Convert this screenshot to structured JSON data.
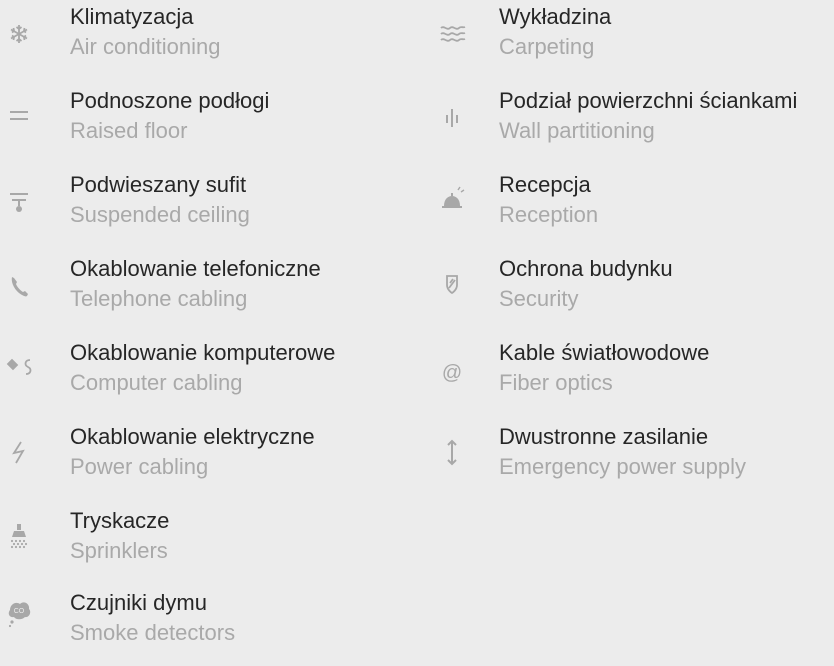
{
  "left_column": [
    {
      "icon": "snowflake-icon",
      "pl": "Klimatyzacja",
      "en": "Air conditioning"
    },
    {
      "icon": "raised-floor-icon",
      "pl": "Podnoszone podłogi",
      "en": "Raised floor"
    },
    {
      "icon": "suspended-ceiling-icon",
      "pl": "Podwieszany sufit",
      "en": "Suspended ceiling"
    },
    {
      "icon": "phone-icon",
      "pl": "Okablowanie telefoniczne",
      "en": "Telephone cabling"
    },
    {
      "icon": "computer-cable-icon",
      "pl": "Okablowanie komputerowe",
      "en": "Computer cabling"
    },
    {
      "icon": "lightning-icon",
      "pl": "Okablowanie elektryczne",
      "en": "Power cabling"
    },
    {
      "icon": "sprinkler-icon",
      "pl": "Tryskacze",
      "en": "Sprinklers"
    },
    {
      "icon": "co-smoke-icon",
      "pl": "Czujniki dymu",
      "en": "Smoke detectors"
    }
  ],
  "right_column": [
    {
      "icon": "waves-icon",
      "pl": "Wykładzina",
      "en": "Carpeting"
    },
    {
      "icon": "partition-icon",
      "pl": "Podział powierzchni ściankami",
      "en": "Wall partitioning"
    },
    {
      "icon": "reception-bell-icon",
      "pl": "Recepcja",
      "en": "Reception"
    },
    {
      "icon": "shield-icon",
      "pl": "Ochrona budynku",
      "en": "Security"
    },
    {
      "icon": "at-sign-icon",
      "pl": "Kable światłowodowe",
      "en": "Fiber optics"
    },
    {
      "icon": "up-down-arrow-icon",
      "pl": "Dwustronne zasilanie",
      "en": "Emergency power supply"
    }
  ],
  "colors": {
    "background": "#ececec",
    "primary_text": "#262626",
    "secondary_text": "#a9a9a9",
    "icon": "#a8a8a8"
  }
}
